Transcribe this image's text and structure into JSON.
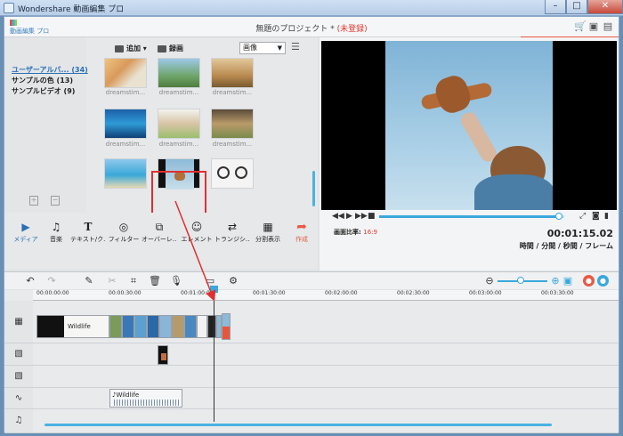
{
  "window": {
    "title": "Wondershare 動画編集 プロ"
  },
  "header": {
    "logo_text": "動画編集 プロ",
    "project_name": "無題のプロジェクト *",
    "unsaved": "(未登録)",
    "icons": [
      "cart-icon",
      "save-icon",
      "menu-icon"
    ]
  },
  "library": {
    "nav": [
      {
        "label": "ユーザーアルバ... (34)",
        "active": true
      },
      {
        "label": "サンプルの色 (13)",
        "active": false
      },
      {
        "label": "サンプルビデオ (9)",
        "active": false
      }
    ],
    "toolbar": {
      "add": "追加",
      "record": "録画",
      "filter_value": "画像"
    },
    "thumb_label": "dreamstim..."
  },
  "functions": [
    {
      "label": "メディア",
      "icon": "media-icon",
      "active": true
    },
    {
      "label": "音楽",
      "icon": "music-icon",
      "active": false
    },
    {
      "label": "テキスト/ク...",
      "icon": "text-icon",
      "active": false
    },
    {
      "label": "フィルター",
      "icon": "filter-icon",
      "active": false
    },
    {
      "label": "オーバーレ...",
      "icon": "overlay-icon",
      "active": false
    },
    {
      "label": "エレメント",
      "icon": "element-icon",
      "active": false
    },
    {
      "label": "トランジシ...",
      "icon": "transition-icon",
      "active": false
    },
    {
      "label": "分割表示",
      "icon": "split-icon",
      "active": false
    },
    {
      "label": "作成",
      "icon": "export-icon",
      "active": false
    }
  ],
  "preview": {
    "aspect_label": "画面比率:",
    "aspect_value": "16:9",
    "timecode": "00:01:15.02",
    "time_units": "時間 / 分間 / 秒間 / フレーム",
    "progress": 0.96
  },
  "timeline": {
    "ruler": [
      "00:00:00:00",
      "00:00:30:00",
      "00:01:00:00",
      "00:01:30:00",
      "00:02:00:00",
      "00:02:30:00",
      "00:03:00:00",
      "00:03:30:00"
    ],
    "video_clip_label": "Wildlife",
    "audio_clip_label": "Wildlife"
  },
  "colors": {
    "accent": "#3aa8dc",
    "alert": "#e03a2f",
    "export": "#e85a45"
  }
}
